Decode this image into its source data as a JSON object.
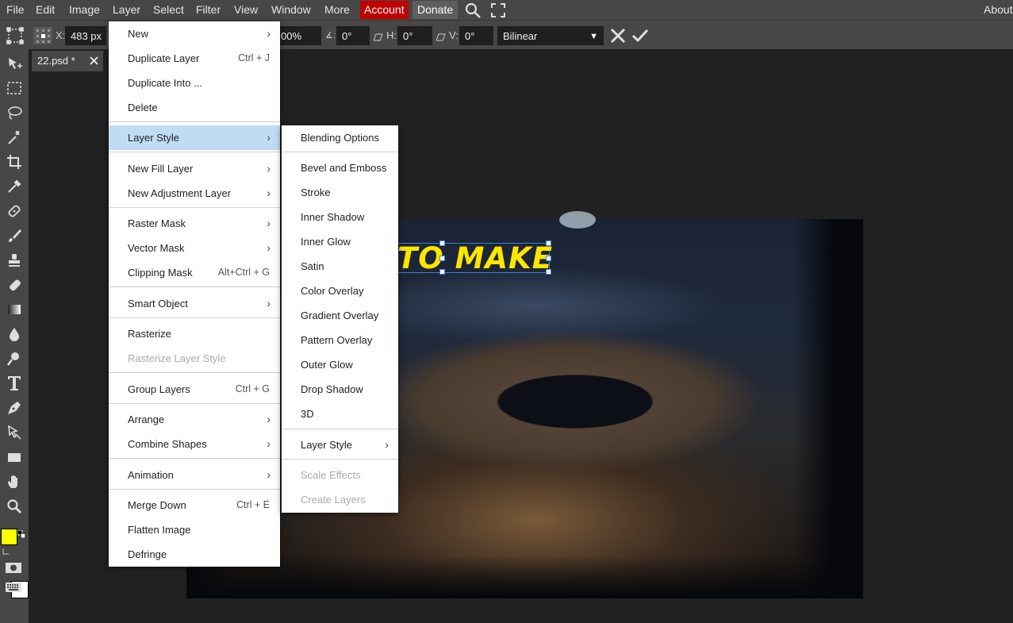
{
  "menubar": {
    "items": [
      "File",
      "Edit",
      "Image",
      "Layer",
      "Select",
      "Filter",
      "View",
      "Window",
      "More"
    ],
    "account": "Account",
    "donate": "Donate",
    "about": "About",
    "colors": {
      "account_bg": "#c00000",
      "donate_bg": "#5e5e5e"
    }
  },
  "options": {
    "x_label": "X:",
    "x_value": "483 px",
    "scale_value": "00%",
    "angle_value": "0°",
    "h_label": "H:",
    "h_value": "0°",
    "v_label": "V:",
    "v_value": "0°",
    "interpolation": "Bilinear"
  },
  "document": {
    "tab_name": "22.psd *",
    "text_layer": "TO MAKE",
    "text_color": "#ffe500"
  },
  "toolbar": {
    "tools": [
      "move-tool-icon",
      "marquee-tool-icon",
      "lasso-tool-icon",
      "magic-wand-icon",
      "crop-tool-icon",
      "eyedropper-icon",
      "healing-brush-icon",
      "brush-tool-icon",
      "clone-stamp-icon",
      "eraser-icon",
      "gradient-tool-icon",
      "blur-tool-icon",
      "dodge-tool-icon",
      "type-tool-icon",
      "pen-tool-icon",
      "path-select-icon",
      "shape-tool-icon",
      "hand-tool-icon",
      "zoom-tool-icon"
    ],
    "foreground_color": "#ffff00",
    "background_color": "#ffffff"
  },
  "layer_menu": {
    "items": [
      {
        "label": "New",
        "arrow": true
      },
      {
        "label": "Duplicate Layer",
        "shortcut": "Ctrl + J"
      },
      {
        "label": "Duplicate Into ..."
      },
      {
        "label": "Delete"
      },
      {
        "label": "Layer Style",
        "arrow": true,
        "highlighted": true
      },
      {
        "label": "New Fill Layer",
        "arrow": true
      },
      {
        "label": "New Adjustment Layer",
        "arrow": true
      },
      {
        "label": "Raster Mask",
        "arrow": true
      },
      {
        "label": "Vector Mask",
        "arrow": true
      },
      {
        "label": "Clipping Mask",
        "shortcut": "Alt+Ctrl + G"
      },
      {
        "label": "Smart Object",
        "arrow": true
      },
      {
        "label": "Rasterize"
      },
      {
        "label": "Rasterize Layer Style",
        "disabled": true
      },
      {
        "label": "Group Layers",
        "shortcut": "Ctrl + G"
      },
      {
        "label": "Arrange",
        "arrow": true
      },
      {
        "label": "Combine Shapes",
        "arrow": true
      },
      {
        "label": "Animation",
        "arrow": true
      },
      {
        "label": "Merge Down",
        "shortcut": "Ctrl + E"
      },
      {
        "label": "Flatten Image"
      },
      {
        "label": "Defringe"
      }
    ]
  },
  "layer_style_menu": {
    "items": [
      {
        "label": "Blending Options"
      },
      {
        "label": "Bevel and Emboss"
      },
      {
        "label": "Stroke"
      },
      {
        "label": "Inner Shadow"
      },
      {
        "label": "Inner Glow"
      },
      {
        "label": "Satin"
      },
      {
        "label": "Color Overlay"
      },
      {
        "label": "Gradient Overlay"
      },
      {
        "label": "Pattern Overlay"
      },
      {
        "label": "Outer Glow"
      },
      {
        "label": "Drop Shadow"
      },
      {
        "label": "3D"
      },
      {
        "label": "Layer Style",
        "arrow": true
      },
      {
        "label": "Scale Effects",
        "disabled": true
      },
      {
        "label": "Create Layers",
        "disabled": true
      }
    ]
  }
}
